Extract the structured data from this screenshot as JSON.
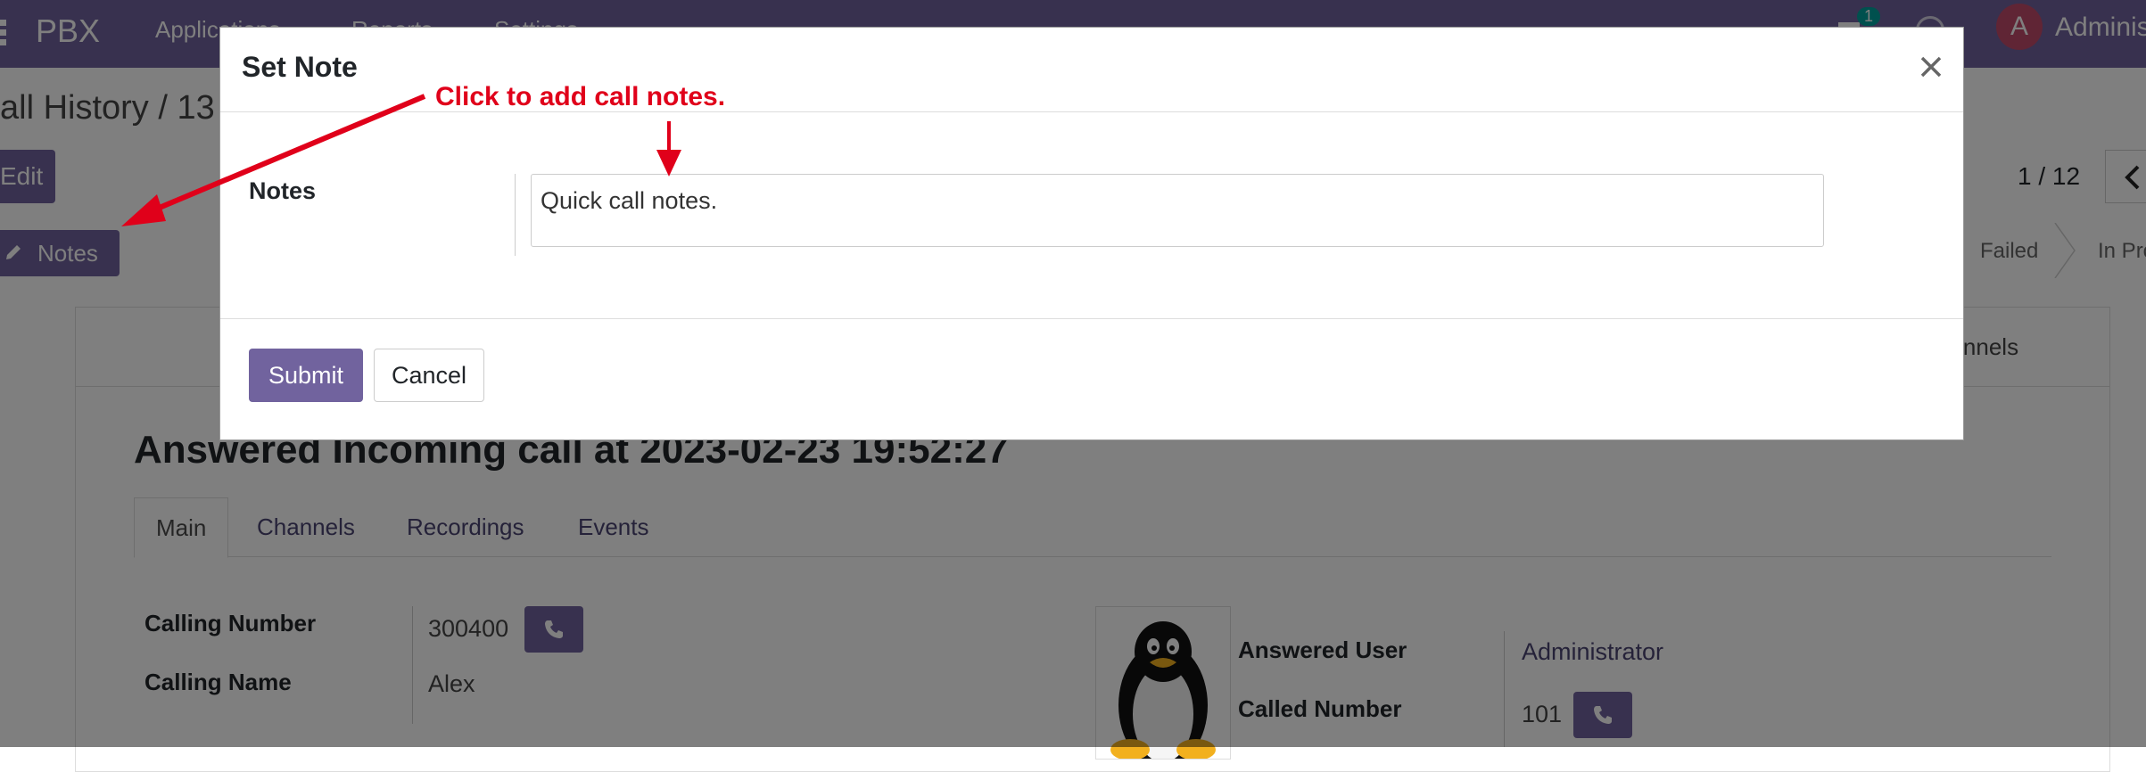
{
  "topbar": {
    "brand": "PBX",
    "menu": [
      "Applications",
      "Reports",
      "Settings"
    ],
    "chat_badge": "1",
    "avatar_letter": "A",
    "user_name": "Administrator"
  },
  "control_panel": {
    "breadcrumb": "all History / 13",
    "edit_label": "Edit",
    "pager": "1 / 12",
    "notes_label": "Notes",
    "status_failed": "Failed",
    "status_in_progress": "In Pro",
    "channels_button": "hannels"
  },
  "record": {
    "title": "Answered Incoming call at 2023-02-23 19:52:27",
    "tabs": [
      "Main",
      "Channels",
      "Recordings",
      "Events"
    ],
    "fields": {
      "calling_number_label": "Calling Number",
      "calling_number": "300400",
      "calling_name_label": "Calling Name",
      "calling_name": "Alex",
      "answered_user_label": "Answered User",
      "answered_user": "Administrator",
      "called_number_label": "Called Number",
      "called_number": "101"
    }
  },
  "dialog": {
    "title": "Set Note",
    "notes_label": "Notes",
    "notes_value": "Quick call notes.",
    "submit_label": "Submit",
    "cancel_label": "Cancel"
  },
  "annotation": {
    "text": "Click to add call notes.",
    "color": "#e0001a"
  },
  "colors": {
    "brand": "#71639e",
    "link": "#4b4472",
    "badge": "#00a09d"
  }
}
